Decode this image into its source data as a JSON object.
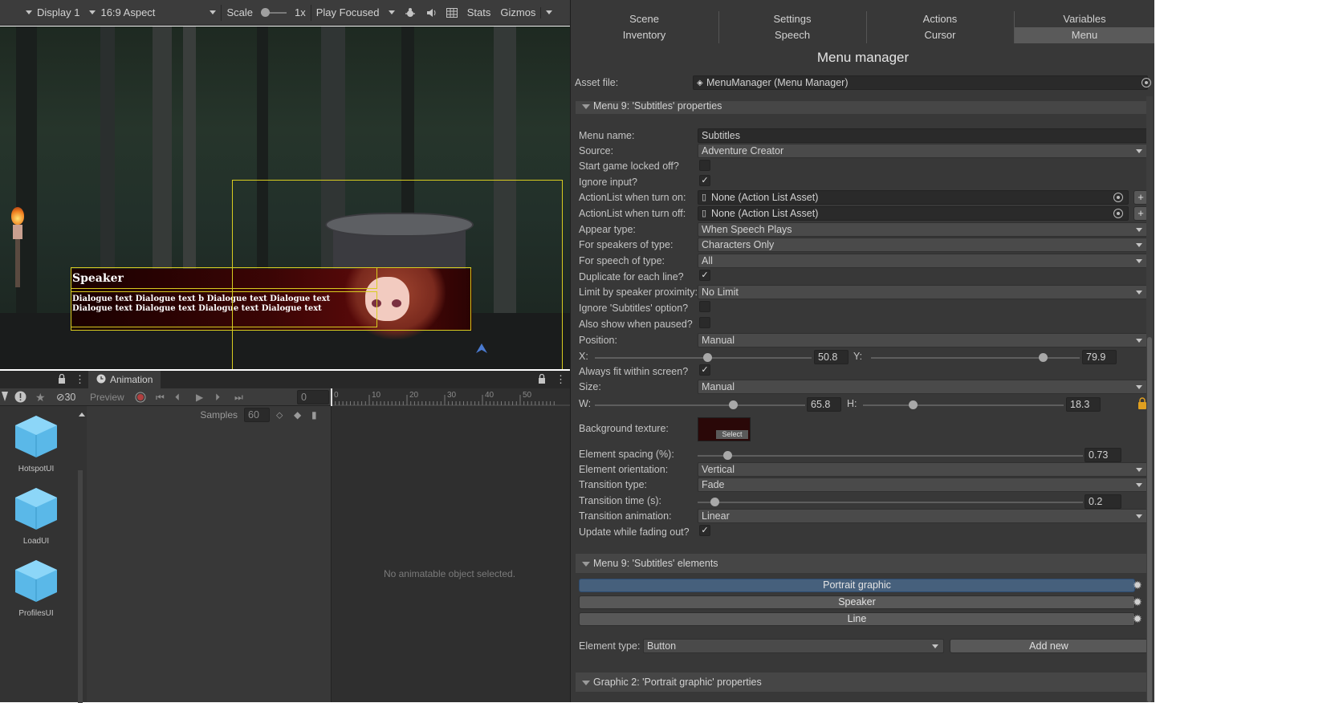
{
  "toolbar": {
    "display": "Display 1",
    "aspect": "16:9 Aspect",
    "scale_label": "Scale",
    "scale_value": "1x",
    "play_mode": "Play Focused",
    "stats": "Stats",
    "gizmos": "Gizmos"
  },
  "scene": {
    "speaker": "Speaker",
    "dialogue": "Dialogue text Dialogue text b Dialogue text Dialogue text Dialogue text Dialogue text Dialogue text Dialogue text"
  },
  "animation": {
    "tab": "Animation",
    "preview": "Preview",
    "frame": "0",
    "samples_label": "Samples",
    "samples": "60",
    "ruler": [
      "0",
      "10",
      "20",
      "30",
      "40",
      "50"
    ],
    "hidden_count": "30",
    "empty": "No animatable object selected.",
    "assets": [
      "HotspotUI",
      "LoadUI",
      "ProfilesUI"
    ]
  },
  "tabs": [
    "Scene",
    "Settings",
    "Actions",
    "Variables",
    "Inventory",
    "Speech",
    "Cursor",
    "Menu"
  ],
  "active_tab": "Menu",
  "title": "Menu manager",
  "asset": {
    "label": "Asset file:",
    "value": "MenuManager (Menu Manager)"
  },
  "props_header": "Menu 9: 'Subtitles' properties",
  "props": {
    "menu_name": {
      "label": "Menu name:",
      "value": "Subtitles"
    },
    "source": {
      "label": "Source:",
      "value": "Adventure Creator"
    },
    "start_locked": {
      "label": "Start game locked off?",
      "checked": false
    },
    "ignore_input": {
      "label": "Ignore input?",
      "checked": true
    },
    "al_on": {
      "label": "ActionList when turn on:",
      "value": "None (Action List Asset)"
    },
    "al_off": {
      "label": "ActionList when turn off:",
      "value": "None (Action List Asset)"
    },
    "appear_type": {
      "label": "Appear type:",
      "value": "When Speech Plays"
    },
    "speakers_type": {
      "label": "For speakers of type:",
      "value": "Characters Only"
    },
    "speech_type": {
      "label": "For speech of type:",
      "value": "All"
    },
    "dup_line": {
      "label": "Duplicate for each line?",
      "checked": true
    },
    "proximity": {
      "label": "Limit by speaker proximity:",
      "value": "No Limit"
    },
    "ignore_subs": {
      "label": "Ignore 'Subtitles' option?",
      "checked": false
    },
    "show_paused": {
      "label": "Also show when paused?",
      "checked": false
    },
    "position": {
      "label": "Position:",
      "value": "Manual"
    },
    "x": {
      "label": "X:",
      "value": "50.8"
    },
    "y": {
      "label": "Y:",
      "value": "79.9"
    },
    "fit_screen": {
      "label": "Always fit within screen?",
      "checked": true
    },
    "size": {
      "label": "Size:",
      "value": "Manual"
    },
    "w": {
      "label": "W:",
      "value": "65.8"
    },
    "h": {
      "label": "H:",
      "value": "18.3"
    },
    "bg_texture": {
      "label": "Background texture:",
      "select": "Select"
    },
    "spacing": {
      "label": "Element spacing (%):",
      "value": "0.73"
    },
    "orientation": {
      "label": "Element orientation:",
      "value": "Vertical"
    },
    "transition_type": {
      "label": "Transition type:",
      "value": "Fade"
    },
    "transition_time": {
      "label": "Transition time (s):",
      "value": "0.2"
    },
    "transition_anim": {
      "label": "Transition animation:",
      "value": "Linear"
    },
    "update_fading": {
      "label": "Update while fading out?",
      "checked": true
    }
  },
  "elements_header": "Menu 9: 'Subtitles' elements",
  "elements": [
    "Portrait graphic",
    "Speaker",
    "Line"
  ],
  "element_type": {
    "label": "Element type:",
    "value": "Button",
    "add": "Add new"
  },
  "graphic_header": "Graphic 2: 'Portrait graphic' properties",
  "colors": {
    "accent": "#46607c",
    "gizmo": "#d8cc20",
    "lock": "#e0a020"
  }
}
